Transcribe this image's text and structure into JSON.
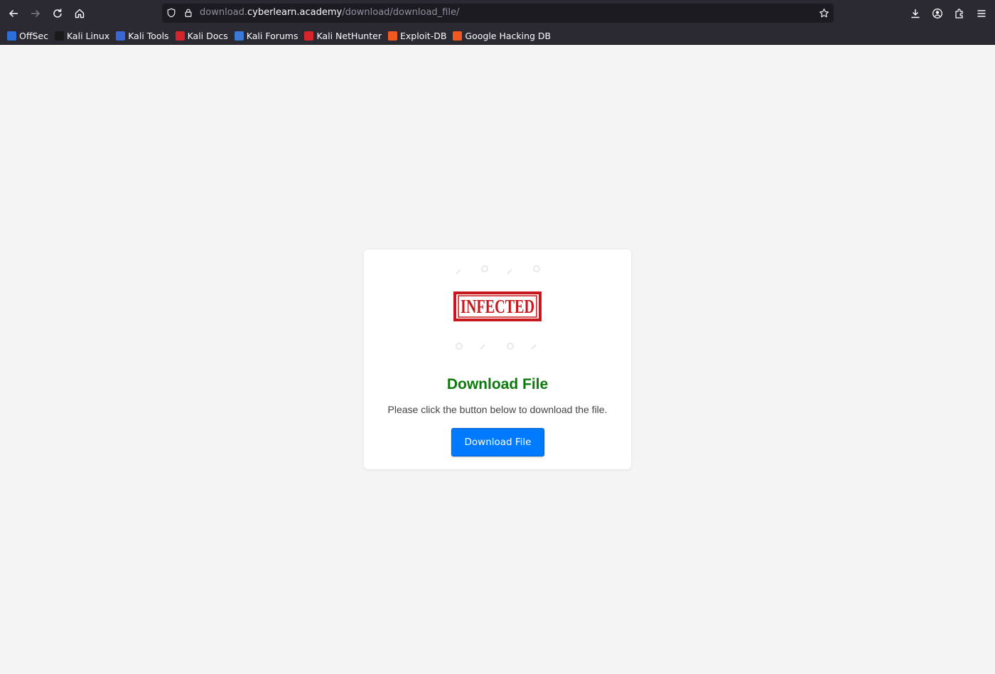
{
  "browser": {
    "url": {
      "prefix": "download.",
      "host": "cyberlearn.academy",
      "path": "/download/download_file/"
    },
    "bookmarks": [
      {
        "label": "OffSec",
        "icon": "offsec-icon",
        "color": "#2d6fd8"
      },
      {
        "label": "Kali Linux",
        "icon": "kali-dragon-icon",
        "color": "#1a1a1a"
      },
      {
        "label": "Kali Tools",
        "icon": "kali-tools-icon",
        "color": "#3a66d6"
      },
      {
        "label": "Kali Docs",
        "icon": "kali-docs-icon",
        "color": "#d6262b"
      },
      {
        "label": "Kali Forums",
        "icon": "kali-forums-icon",
        "color": "#3a7ad6"
      },
      {
        "label": "Kali NetHunter",
        "icon": "nethunter-icon",
        "color": "#d6262b"
      },
      {
        "label": "Exploit-DB",
        "icon": "exploit-db-icon",
        "color": "#f2581f"
      },
      {
        "label": "Google Hacking DB",
        "icon": "ghdb-icon",
        "color": "#f2581f"
      }
    ]
  },
  "page": {
    "stamp_text": "INFECTED",
    "title": "Download File",
    "description": "Please click the button below to download the file.",
    "button_label": "Download File",
    "colors": {
      "title": "#0a7b0a",
      "button": "#007bff",
      "stamp": "#c8171d"
    }
  }
}
